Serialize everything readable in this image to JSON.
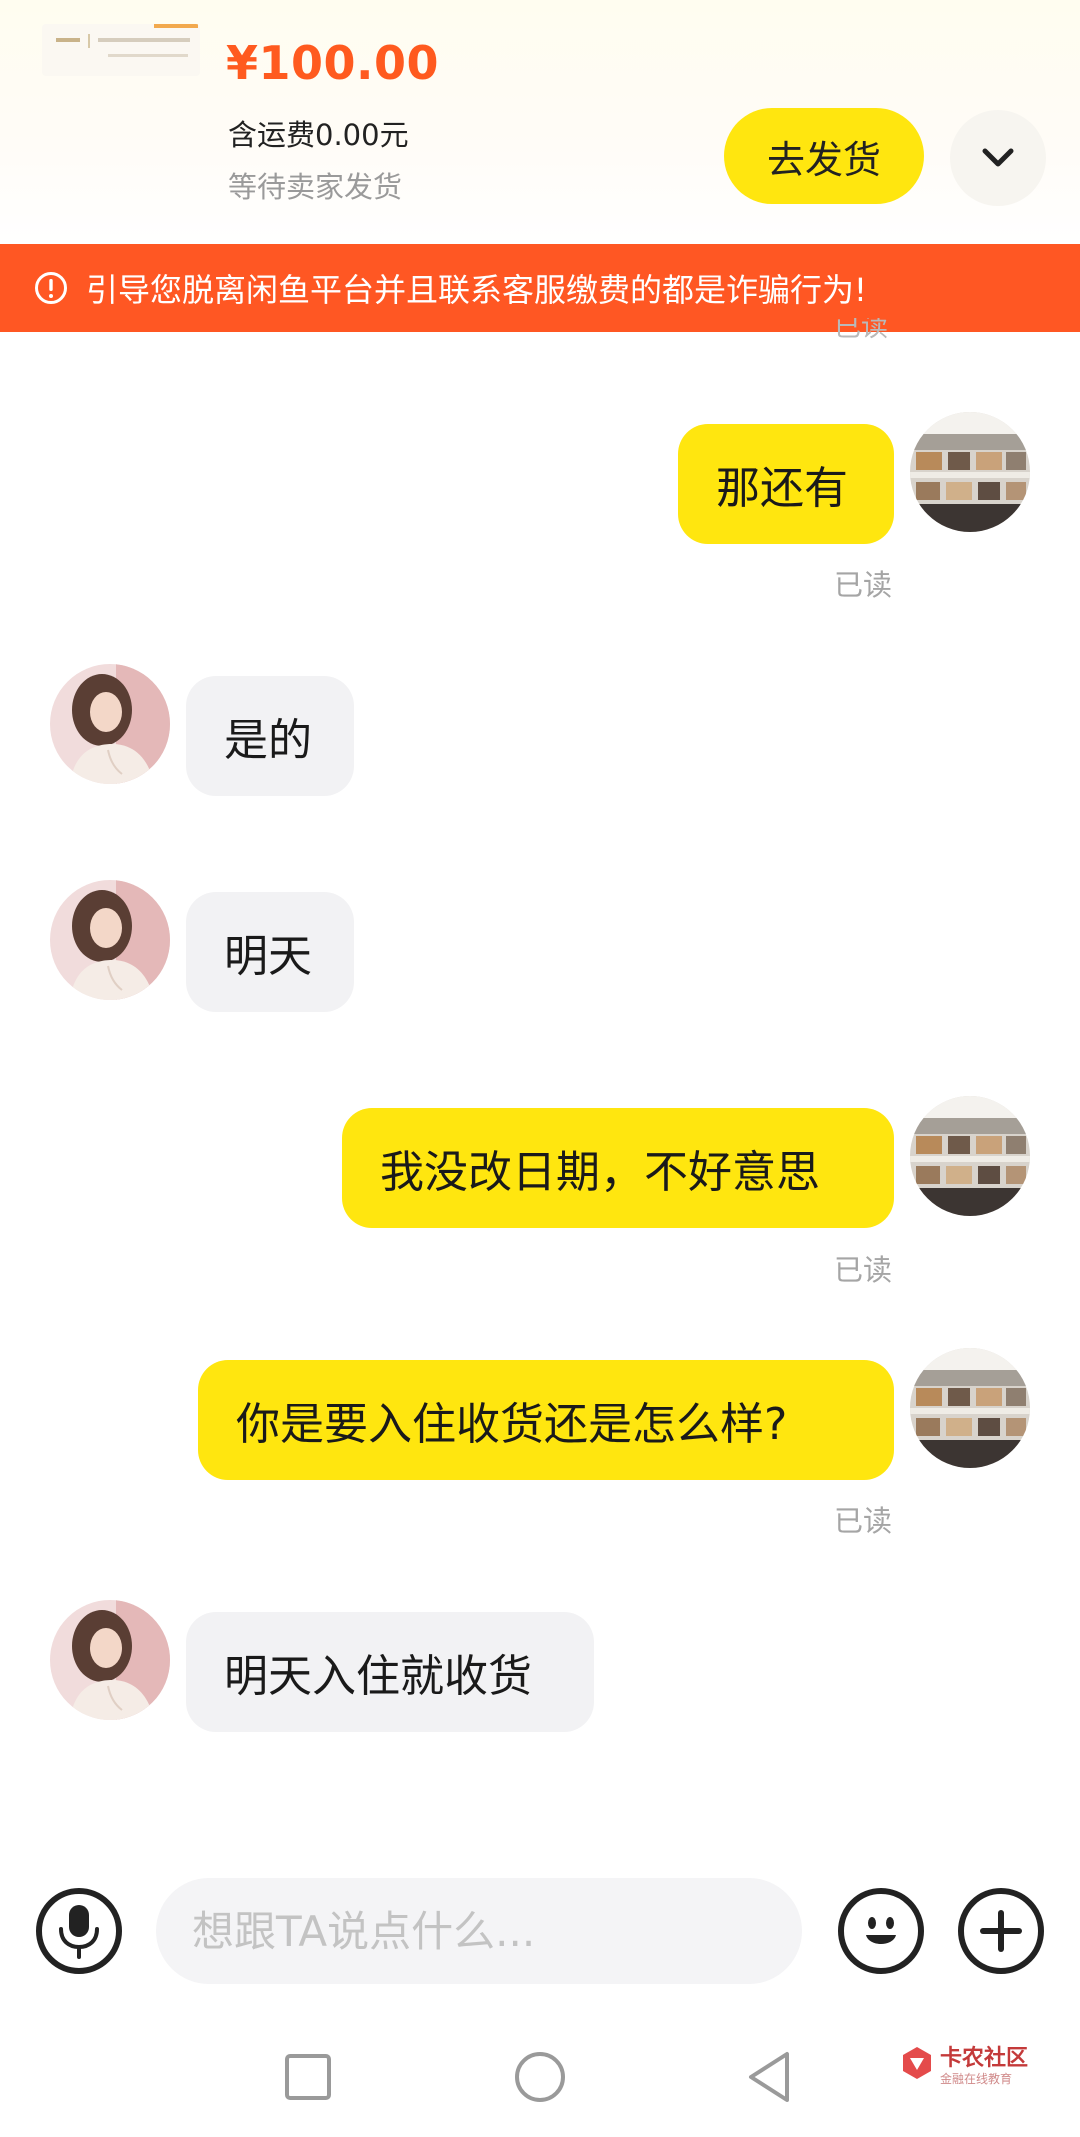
{
  "order": {
    "price": "¥100.00",
    "shipping": "含运费0.00元",
    "status": "等待卖家发货",
    "ship_button": "去发货"
  },
  "warning": {
    "text": "引导您脱离闲鱼平台并且联系客服缴费的都是诈骗行为!"
  },
  "chat": {
    "partial_read": "已读",
    "messages": [
      {
        "sender": "me",
        "text": "那还有",
        "status": "已读"
      },
      {
        "sender": "them",
        "text": "是的"
      },
      {
        "sender": "them",
        "text": "明天"
      },
      {
        "sender": "me",
        "text": "我没改日期，不好意思",
        "status": "已读"
      },
      {
        "sender": "me",
        "text": "你是要入住收货还是怎么样?",
        "status": "已读"
      },
      {
        "sender": "them",
        "text": "明天入住就收货"
      }
    ]
  },
  "input": {
    "placeholder": "想跟TA说点什么..."
  },
  "watermark": {
    "main": "卡农社区",
    "sub": "金融在线教育"
  },
  "colors": {
    "accent_yellow": "#ffe60f",
    "price_orange": "#ff5a1f",
    "warning_bg": "#ff5723",
    "bubble_other": "#f2f2f4"
  },
  "icons": {
    "expand": "chevron-down-icon",
    "warning": "exclamation-circle-icon",
    "voice": "microphone-icon",
    "emoji": "emoji-icon",
    "more": "plus-icon",
    "nav_recent": "square-icon",
    "nav_home": "circle-icon",
    "nav_back": "triangle-back-icon"
  }
}
